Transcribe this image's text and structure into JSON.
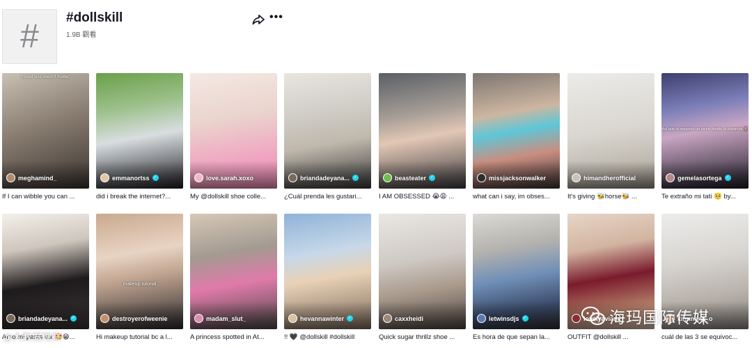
{
  "header": {
    "title": "#dollskill",
    "views": "1.9B 觀看",
    "hash_glyph": "#",
    "more_glyph": "•••"
  },
  "videos": [
    {
      "user": "meghamind_",
      "verified": false,
      "desc": "If I can wibble you can ...",
      "caption_top": "myself size doesn't matter:",
      "bg": "linear-gradient(160deg,#c9bfb3 0%,#8a7e72 45%,#3b3430 100%)",
      "avatar": "#b48a6a"
    },
    {
      "user": "emmanortss",
      "verified": true,
      "desc": "did i break the internet?...",
      "bg": "linear-gradient(170deg,#6aa04a 0%,#9cc08a 30%,#d8dde0 55%,#1f1f24 100%)",
      "avatar": "#e2c6a4"
    },
    {
      "user": "love.sarah.xoxo",
      "verified": false,
      "desc": "My @dollskill shoe colle...",
      "bg": "linear-gradient(170deg,#f4e9e3 0%,#ead3cd 40%,#f0a3c0 75%,#e889b0 100%)",
      "avatar": "#f2b8c6"
    },
    {
      "user": "briandadeyana...",
      "verified": true,
      "desc": "¿Cuál prenda les gustari...",
      "bg": "linear-gradient(170deg,#e8e6df 0%,#cfcdc6 35%,#bfb8ac 60%,#3a3a3a 100%)",
      "avatar": "#7a6a5a"
    },
    {
      "user": "beasteater",
      "verified": true,
      "desc": "I AM OBSESSED 😭😩 ...",
      "bg": "linear-gradient(170deg,#5a5f66 0%,#a49c95 35%,#e2c7b5 55%,#3d3d40 100%)",
      "avatar": "#6fbf4e"
    },
    {
      "user": "missjacksonwalker",
      "verified": false,
      "desc": "what can i say, im obses...",
      "bg": "linear-gradient(170deg,#7c7672 0%,#cdb6a0 35%,#5fc6d8 50%,#c98e80 70%,#3d3534 100%)",
      "avatar": "#2d2d2d"
    },
    {
      "user": "himandherofficial",
      "verified": false,
      "desc": "It's giving 🐝horse🐝 ...",
      "bg": "linear-gradient(170deg,#ecebe8 0%,#d9d6d0 50%,#bdb7ad 80%,#8f8a82 100%)",
      "avatar": "#c7c2ba"
    },
    {
      "user": "gemelasortega",
      "verified": true,
      "desc": "Te extraño mi tati 🥺 by...",
      "caption_mid": "Así que le organice un picnic desde la distancia 🌷",
      "bg": "linear-gradient(170deg,#3d3f6e 0%,#7c7fb8 30%,#c9a6c3 50%,#1d1c26 100%)",
      "avatar": "#b7888a"
    },
    {
      "user": "briandadeyana...",
      "verified": true,
      "desc": "Amo mi pants lsx 🤩😁...",
      "bg": "linear-gradient(170deg,#f3f0ea 0%,#cfc6bd 30%,#1e1b1c 60%,#3b3536 100%)",
      "avatar": "#7a6a5a"
    },
    {
      "user": "destroyerofweenie",
      "verified": false,
      "desc": "Hi makeup tutorial bc a l...",
      "caption_mid": "makeup tutorial",
      "bg": "linear-gradient(170deg,#c9a98f 0%,#e8d4c3 35%,#bfa38f 55%,#2b2a2d 100%)",
      "avatar": "#c48f6d"
    },
    {
      "user": "madam_slut_",
      "verified": false,
      "desc": "A princess spotted in At...",
      "bg": "linear-gradient(170deg,#d7c8b7 0%,#a39a91 35%,#e07aa9 60%,#4c4a48 100%)",
      "avatar": "#d88fb1"
    },
    {
      "user": "hevannawinter",
      "verified": true,
      "desc": "!! 🖤 @dollskill #dollskill",
      "bg": "linear-gradient(170deg,#8fb3d8 0%,#c7d8e8 35%,#e8d1b5 55%,#7c6a5d 100%)",
      "avatar": "#d8c19f"
    },
    {
      "user": "caxxheidi",
      "verified": false,
      "desc": "Quick sugar thrillz shoe ...",
      "bg": "linear-gradient(170deg,#e9e7e4 0%,#cfc9c4 40%,#a99a8c 65%,#4d4540 100%)",
      "avatar": "#9c8a7c"
    },
    {
      "user": "letwinsdjs",
      "verified": true,
      "desc": "Es hora de que sepan la...",
      "bg": "linear-gradient(170deg,#dcdad6 0%,#b5b3ae 30%,#6f8fb7 55%,#3b4b6a 80%,#2e2e30 100%)",
      "avatar": "#5b7bb0"
    },
    {
      "user": "lovelyaviana",
      "verified": false,
      "desc": "OUTFIT @dollskill ...",
      "bg": "linear-gradient(170deg,#e6d5c7 0%,#d2b4a0 30%,#7a1b2c 55%,#b27c66 80%,#d8c1b0 100%)",
      "avatar": "#8a2b3a"
    },
    {
      "user": "kinnnnny_o",
      "verified": false,
      "desc": "cuál de las 3 se equivoc...",
      "bg": "linear-gradient(170deg,#ececeb 0%,#d8d5d1 40%,#b8b2ab 70%,#85807a 100%)",
      "avatar": "#b98d70"
    }
  ],
  "watermark": {
    "text": "海玛国际传媒",
    "bottom_left": "@大数据观察"
  }
}
